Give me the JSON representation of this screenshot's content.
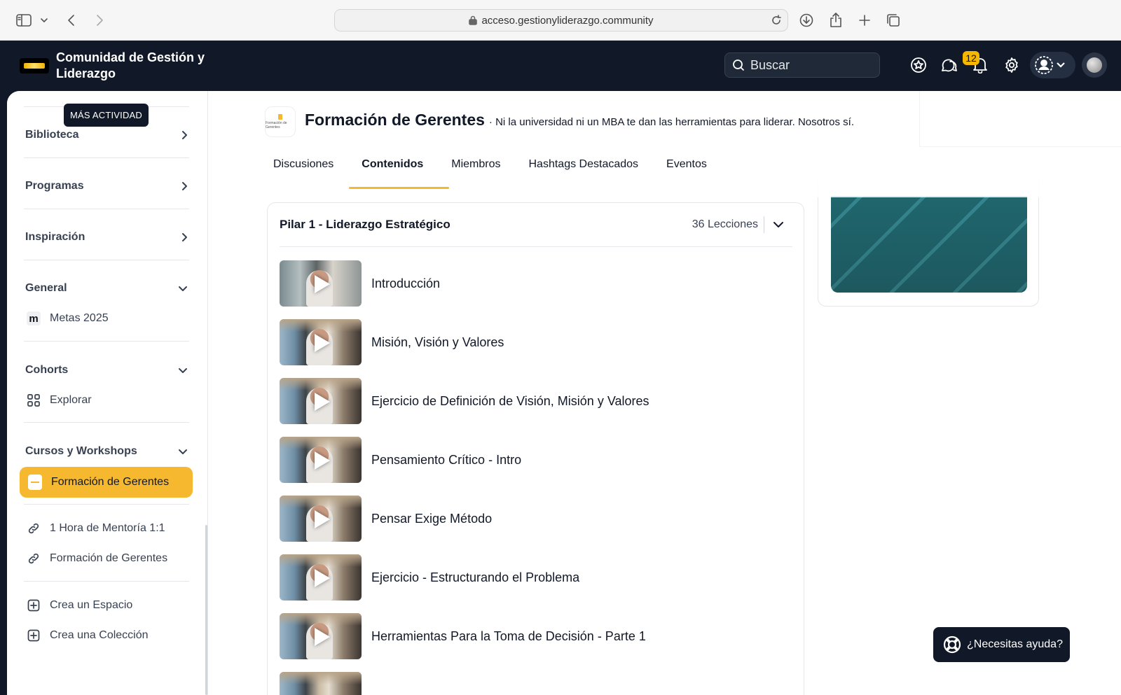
{
  "browser": {
    "url": "acceso.gestionyliderazgo.community"
  },
  "header": {
    "brand": "Comunidad de Gestión y Liderazgo",
    "search_placeholder": "Buscar",
    "notifications_count": "12"
  },
  "sidebar": {
    "tooltip": "MÁS ACTIVIDAD",
    "sections": {
      "biblioteca": "Biblioteca",
      "programas": "Programas",
      "inspiracion": "Inspiración",
      "general": "General",
      "cohorts": "Cohorts",
      "cursos": "Cursos y Workshops"
    },
    "items": {
      "metas": "Metas 2025",
      "explorar": "Explorar",
      "formacion_active": "Formación de Gerentes",
      "mentoria": "1 Hora de Mentoría 1:1",
      "formacion_link": "Formación de Gerentes",
      "crea_espacio": "Crea un Espacio",
      "crea_coleccion": "Crea una Colección"
    }
  },
  "space": {
    "title": "Formación de Gerentes",
    "description": "· Ni la universidad ni un MBA te dan las herramientas para liderar. Nosotros sí.",
    "logo_text": "Formación de Gerentes",
    "tabs": [
      "Discusiones",
      "Contenidos",
      "Miembros",
      "Hashtags Destacados",
      "Eventos"
    ],
    "active_tab": "Contenidos"
  },
  "course": {
    "section_title": "Pilar 1 - Liderazgo Estratégico",
    "lesson_count": "36 Lecciones",
    "lessons": [
      "Introducción",
      "Misión, Visión y Valores",
      "Ejercicio de Definición de Visión, Misión y Valores",
      "Pensamiento Crítico - Intro",
      "Pensar Exige Método",
      "Ejercicio - Estructurando el Problema",
      "Herramientas Para la Toma de Decisión - Parte 1"
    ]
  },
  "help": {
    "label": "¿Necesitas ayuda?"
  },
  "colors": {
    "accent": "#f5b82e",
    "header_bg": "#111827"
  }
}
